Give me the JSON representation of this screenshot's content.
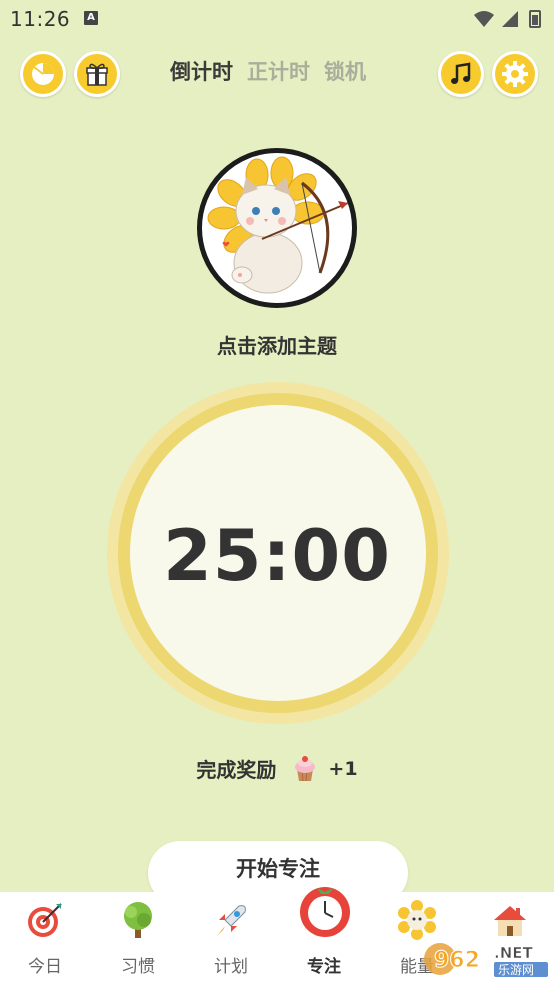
{
  "status_bar": {
    "time": "11:26",
    "notification_icon": "A"
  },
  "header": {
    "tabs": [
      {
        "label": "倒计时",
        "active": true
      },
      {
        "label": "正计时",
        "active": false
      },
      {
        "label": "锁机",
        "active": false
      }
    ],
    "left_icons": [
      "stats-pie-icon",
      "gift-icon"
    ],
    "right_icons": [
      "music-note-icon",
      "settings-gear-icon"
    ]
  },
  "theme": {
    "label": "点击添加主题",
    "image": "cat-archer-avatar"
  },
  "timer": {
    "display": "25:00"
  },
  "reward": {
    "label": "完成奖励",
    "icon": "cupcake-icon",
    "amount": "+1"
  },
  "start_button": {
    "label": "开始专注"
  },
  "bottom_nav": {
    "items": [
      {
        "label": "今日",
        "icon": "target-icon",
        "active": false
      },
      {
        "label": "习惯",
        "icon": "tree-icon",
        "active": false
      },
      {
        "label": "计划",
        "icon": "rocket-icon",
        "active": false
      },
      {
        "label": "专注",
        "icon": "tomato-clock-icon",
        "active": true
      },
      {
        "label": "能量",
        "icon": "sunflower-icon",
        "active": false
      },
      {
        "label": "",
        "icon": "house-icon",
        "active": false
      }
    ]
  },
  "watermark": {
    "text_main": "962",
    "text_suffix": ".NET",
    "text_sub": "乐游网"
  },
  "colors": {
    "background": "#e6efc1",
    "accent_yellow": "#f7cb2d",
    "ring": "#ecd770"
  }
}
